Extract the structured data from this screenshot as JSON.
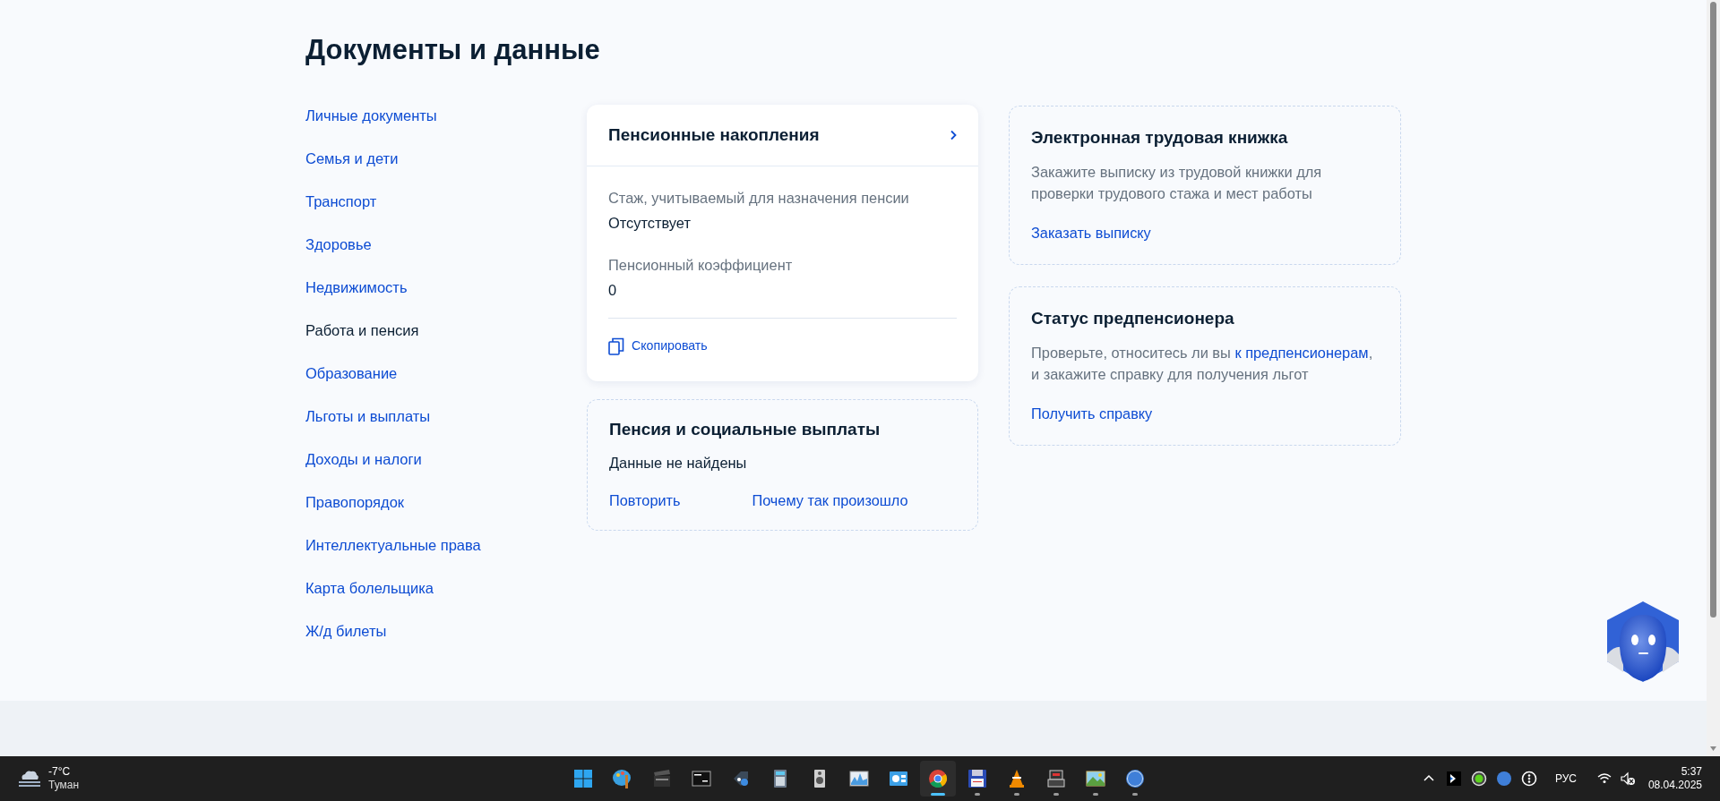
{
  "page": {
    "title": "Документы и данные"
  },
  "sidebar": {
    "items": [
      {
        "label": "Личные документы",
        "selected": false
      },
      {
        "label": "Семья и дети",
        "selected": false
      },
      {
        "label": "Транспорт",
        "selected": false
      },
      {
        "label": "Здоровье",
        "selected": false
      },
      {
        "label": "Недвижимость",
        "selected": false
      },
      {
        "label": "Работа и пенсия",
        "selected": true
      },
      {
        "label": "Образование",
        "selected": false
      },
      {
        "label": "Льготы и выплаты",
        "selected": false
      },
      {
        "label": "Доходы и налоги",
        "selected": false
      },
      {
        "label": "Правопорядок",
        "selected": false
      },
      {
        "label": "Интеллектуальные права",
        "selected": false
      },
      {
        "label": "Карта болельщика",
        "selected": false
      },
      {
        "label": "Ж/д билеты",
        "selected": false
      }
    ]
  },
  "pension_savings": {
    "title": "Пенсионные накопления",
    "fields": [
      {
        "label": "Стаж, учитываемый для назначения пенсии",
        "value": "Отсутствует"
      },
      {
        "label": "Пенсионный коэффициент",
        "value": "0"
      }
    ],
    "copy_action": "Скопировать"
  },
  "pension_payments": {
    "title": "Пенсия и социальные выплаты",
    "message": "Данные не найдены",
    "links": [
      "Повторить",
      "Почему так произошло"
    ]
  },
  "side_cards": [
    {
      "title": "Электронная трудовая книжка",
      "description_lines": [
        [
          {
            "kind": "text",
            "text": "Закажите выписку из трудовой книжки для"
          }
        ],
        [
          {
            "kind": "text",
            "text": "проверки трудового стажа и мест работы"
          }
        ]
      ],
      "action": "Заказать выписку"
    },
    {
      "title": "Статус предпенсионера",
      "description_lines": [
        [
          {
            "kind": "text",
            "text": "Проверьте, относитесь ли вы"
          },
          {
            "kind": "link",
            "text": "к предпенсионерам"
          },
          {
            "kind": "text",
            "text": ","
          }
        ],
        [
          {
            "kind": "text",
            "text": "и закажите справку для получения льгот"
          }
        ]
      ],
      "action": "Получить справку"
    }
  ],
  "taskbar": {
    "weather": {
      "temperature": "-7°C",
      "condition": "Туман"
    },
    "apps": [
      {
        "running": false,
        "selected": false
      },
      {
        "running": false,
        "selected": false
      },
      {
        "running": false,
        "selected": false
      },
      {
        "running": false,
        "selected": false
      },
      {
        "running": false,
        "selected": false
      },
      {
        "running": false,
        "selected": false
      },
      {
        "running": false,
        "selected": false
      },
      {
        "running": false,
        "selected": false
      },
      {
        "running": false,
        "selected": false
      },
      {
        "running": true,
        "selected": true
      },
      {
        "running": true,
        "selected": false
      },
      {
        "running": true,
        "selected": false
      },
      {
        "running": true,
        "selected": false
      },
      {
        "running": true,
        "selected": false
      },
      {
        "running": true,
        "selected": false
      }
    ],
    "language": "РУС",
    "time": "5:37",
    "date": "08.04.2025"
  }
}
